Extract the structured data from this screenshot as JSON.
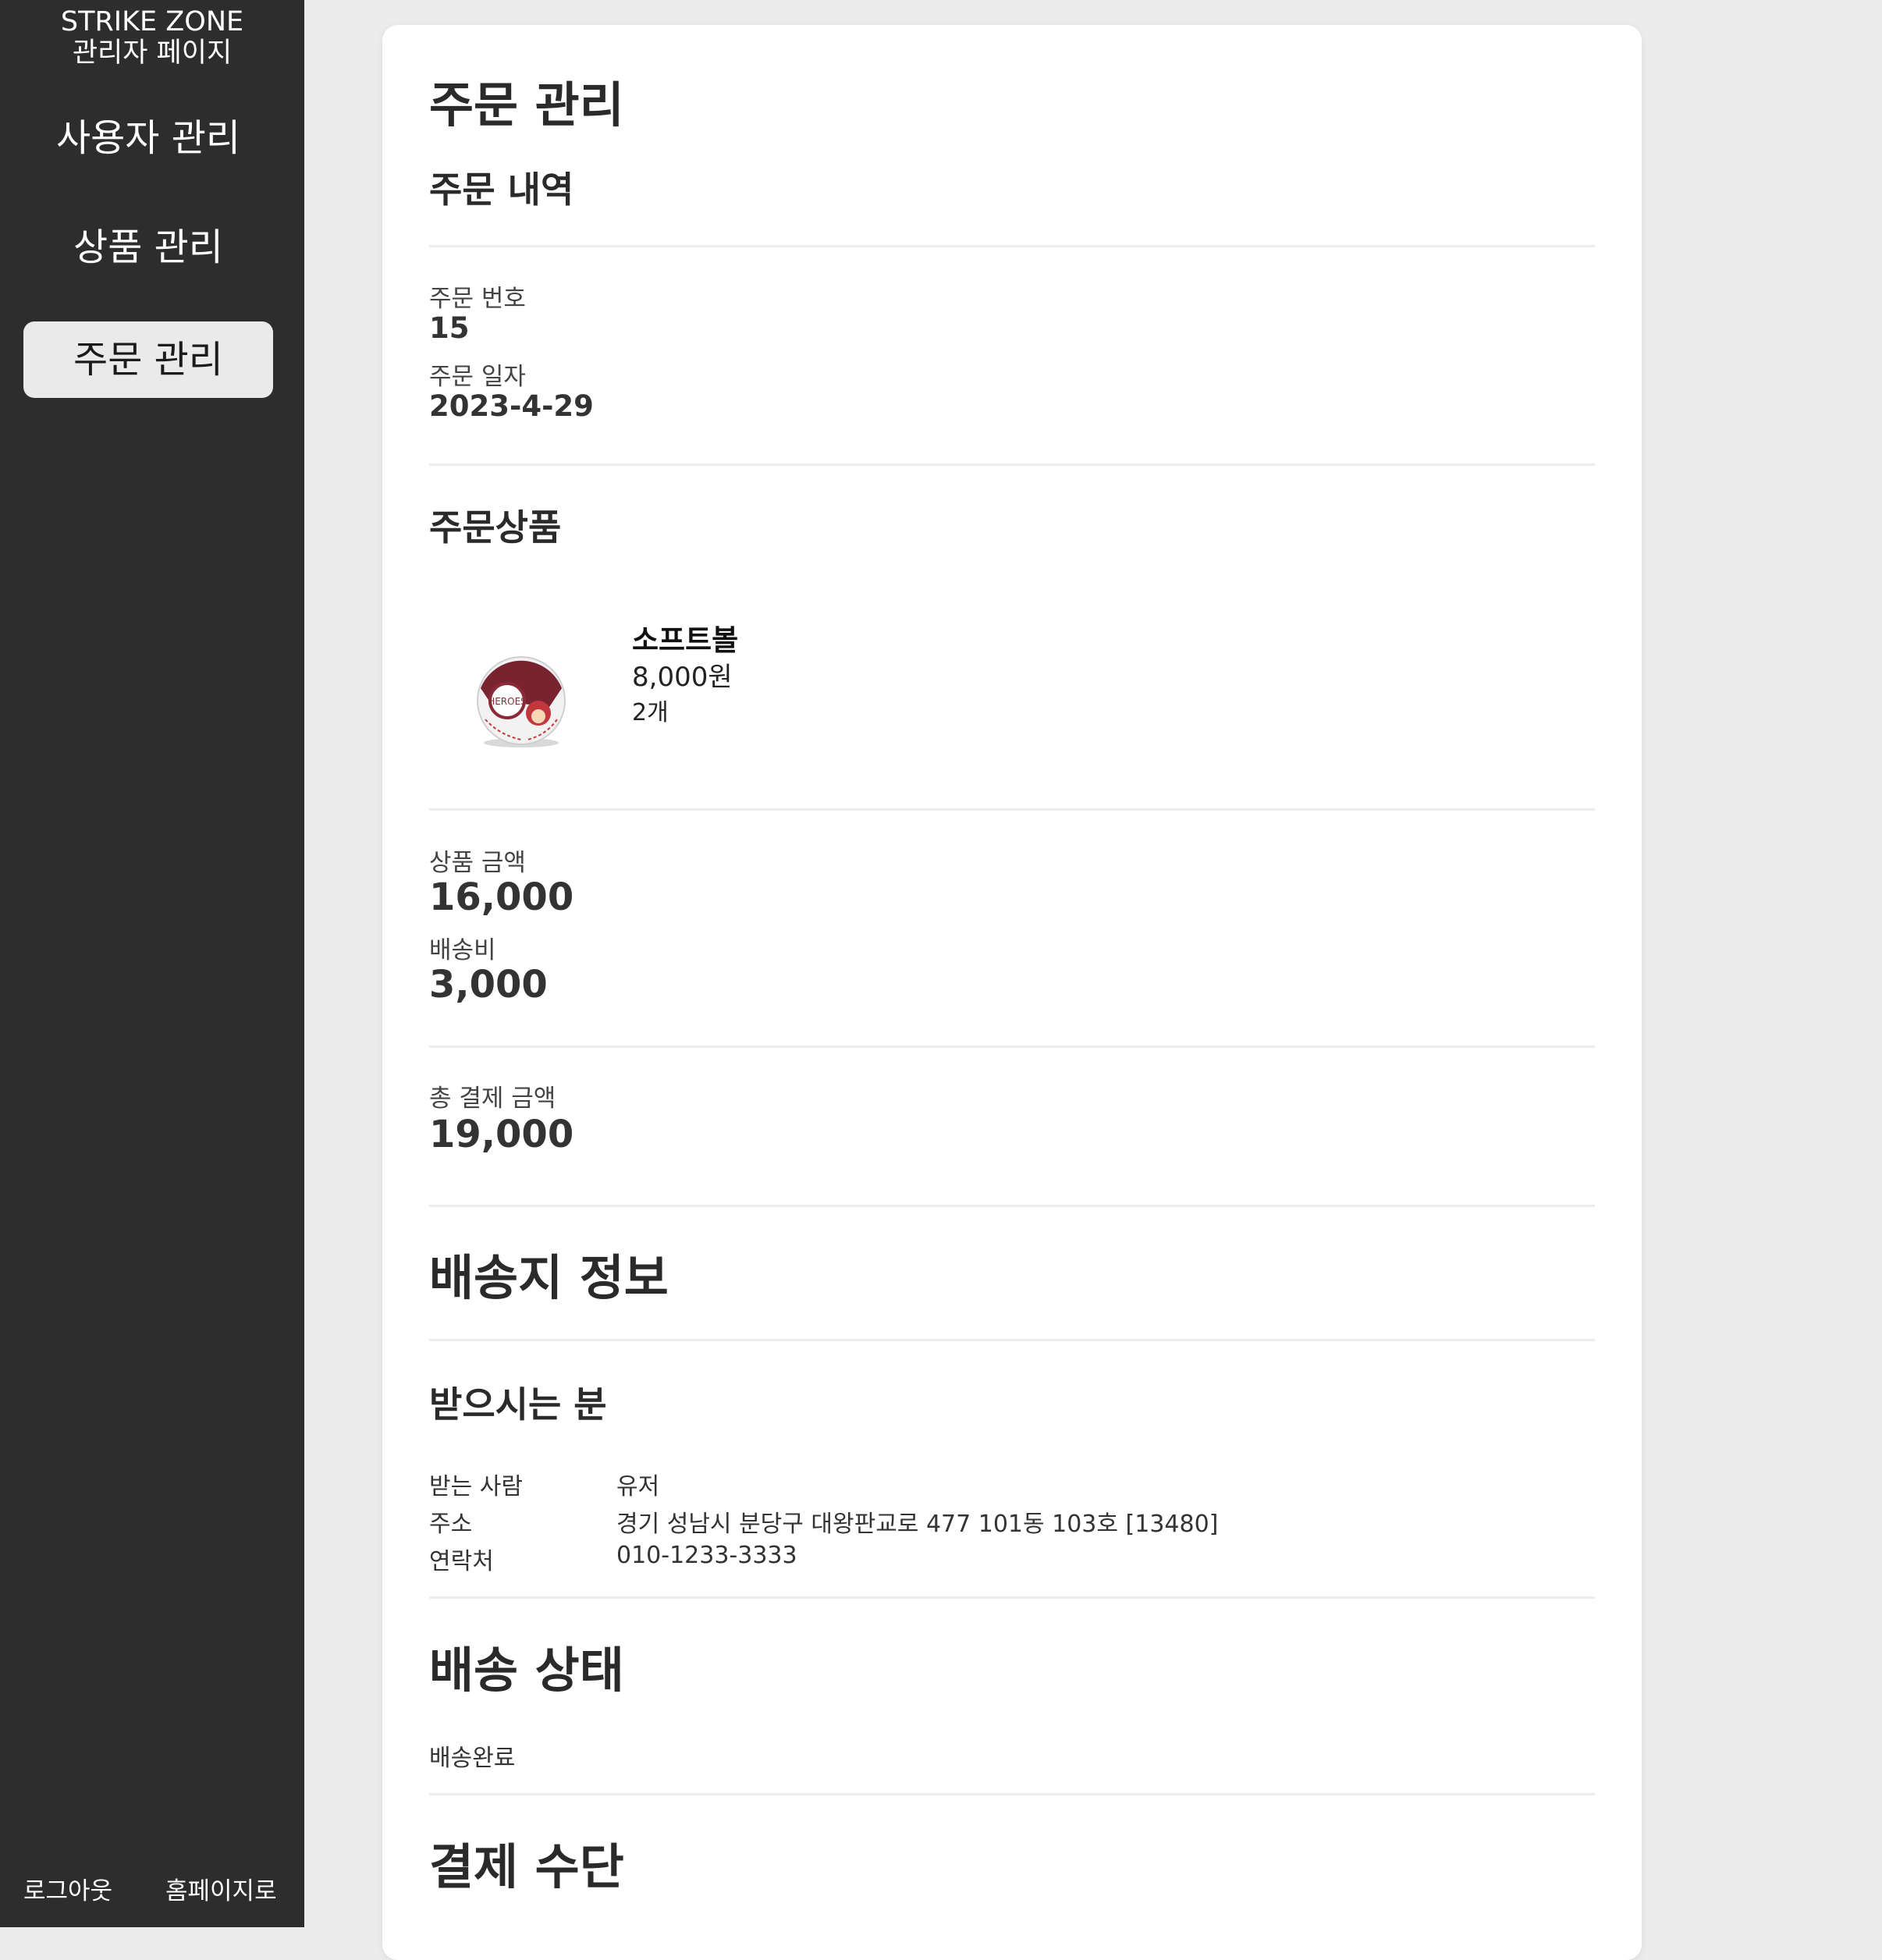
{
  "sidebar": {
    "brand_line1": "STRIKE ZONE",
    "brand_line2": "관리자 페이지",
    "items": [
      {
        "label": "사용자 관리"
      },
      {
        "label": "상품 관리"
      },
      {
        "label": "주문 관리"
      }
    ],
    "logout": "로그아웃",
    "homepage": "홈페이지로"
  },
  "main": {
    "title": "주문 관리",
    "order_history_title": "주문 내역",
    "order_number_label": "주문 번호",
    "order_number": "15",
    "order_date_label": "주문 일자",
    "order_date": "2023-4-29",
    "ordered_items_title": "주문상품",
    "product": {
      "name": "소프트볼",
      "price": "8,000원",
      "quantity": "2개",
      "image_icon": "softball-image"
    },
    "product_amount_label": "상품 금액",
    "product_amount": "16,000",
    "shipping_fee_label": "배송비",
    "shipping_fee": "3,000",
    "total_label": "총 결제 금액",
    "total": "19,000",
    "shipping_info_title": "배송지 정보",
    "recipient_title": "받으시는 분",
    "recipient_name_label": "받는 사람",
    "recipient_name": "유저",
    "address_label": "주소",
    "address": "경기 성남시 분당구 대왕판교로 477 101동 103호 [13480]",
    "phone_label": "연락처",
    "phone": "010-1233-3333",
    "delivery_status_title": "배송 상태",
    "delivery_status": "배송완료",
    "payment_method_title": "결제 수단"
  },
  "colors": {
    "sidebar_bg": "#2d2d2d",
    "active_item_bg": "#eaeaea",
    "page_bg": "#ececec",
    "card_bg": "#ffffff"
  }
}
